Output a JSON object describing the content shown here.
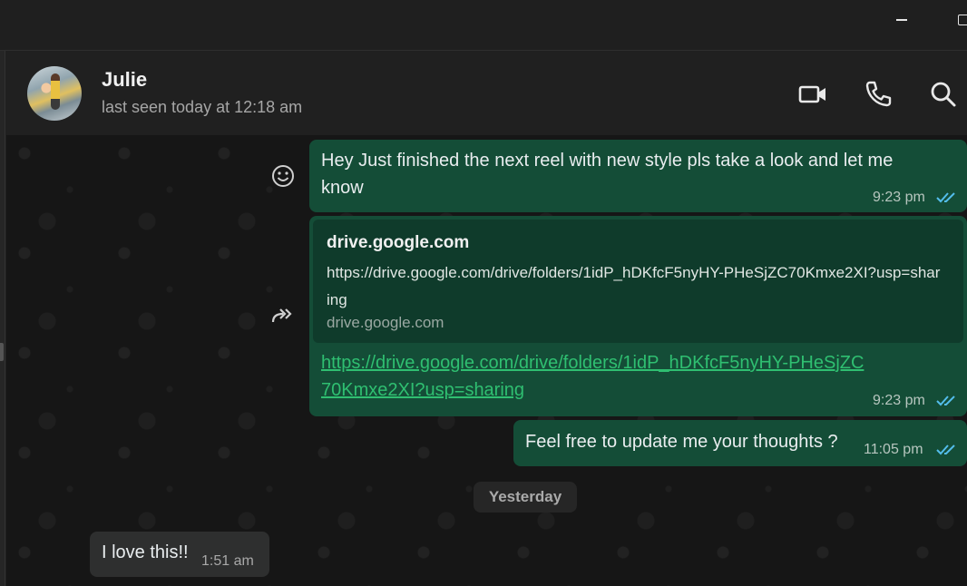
{
  "window": {
    "minimize_icon": "minimize-icon",
    "maximize_icon": "maximize-icon"
  },
  "header": {
    "contact_name": "Julie",
    "last_seen": "last seen today at 12:18 am",
    "icons": [
      "video-call-icon",
      "voice-call-icon",
      "search-icon"
    ]
  },
  "messages": [
    {
      "direction": "outgoing",
      "text_line1": "Hey Just finished the next reel with new style pls take a look and let me",
      "text_line2": "know",
      "time": "9:23 pm",
      "status": "read"
    },
    {
      "direction": "outgoing",
      "preview_title": "drive.google.com",
      "preview_desc": "https://drive.google.com/drive/folders/1idP_hDKfcF5nyHY-PHeSjZC70Kmxe2XI?usp=sharing",
      "preview_domain": "drive.google.com",
      "link": "https://drive.google.com/drive/folders/1idP_hDKfcF5nyHY-PHeSjZC70Kmxe2XI?usp=sharing",
      "time": "9:23 pm",
      "status": "read"
    },
    {
      "direction": "outgoing",
      "text": "Feel free to update me your thoughts ?",
      "time": "11:05 pm",
      "status": "read"
    },
    {
      "direction": "incoming",
      "text": "I love this!!",
      "time": "1:51 am"
    }
  ],
  "date_divider": "Yesterday",
  "colors": {
    "outgoing_bubble": "#144d37",
    "incoming_bubble": "#2e2f2f",
    "link": "#2fbf71",
    "read_ticks": "#53bdeb"
  }
}
